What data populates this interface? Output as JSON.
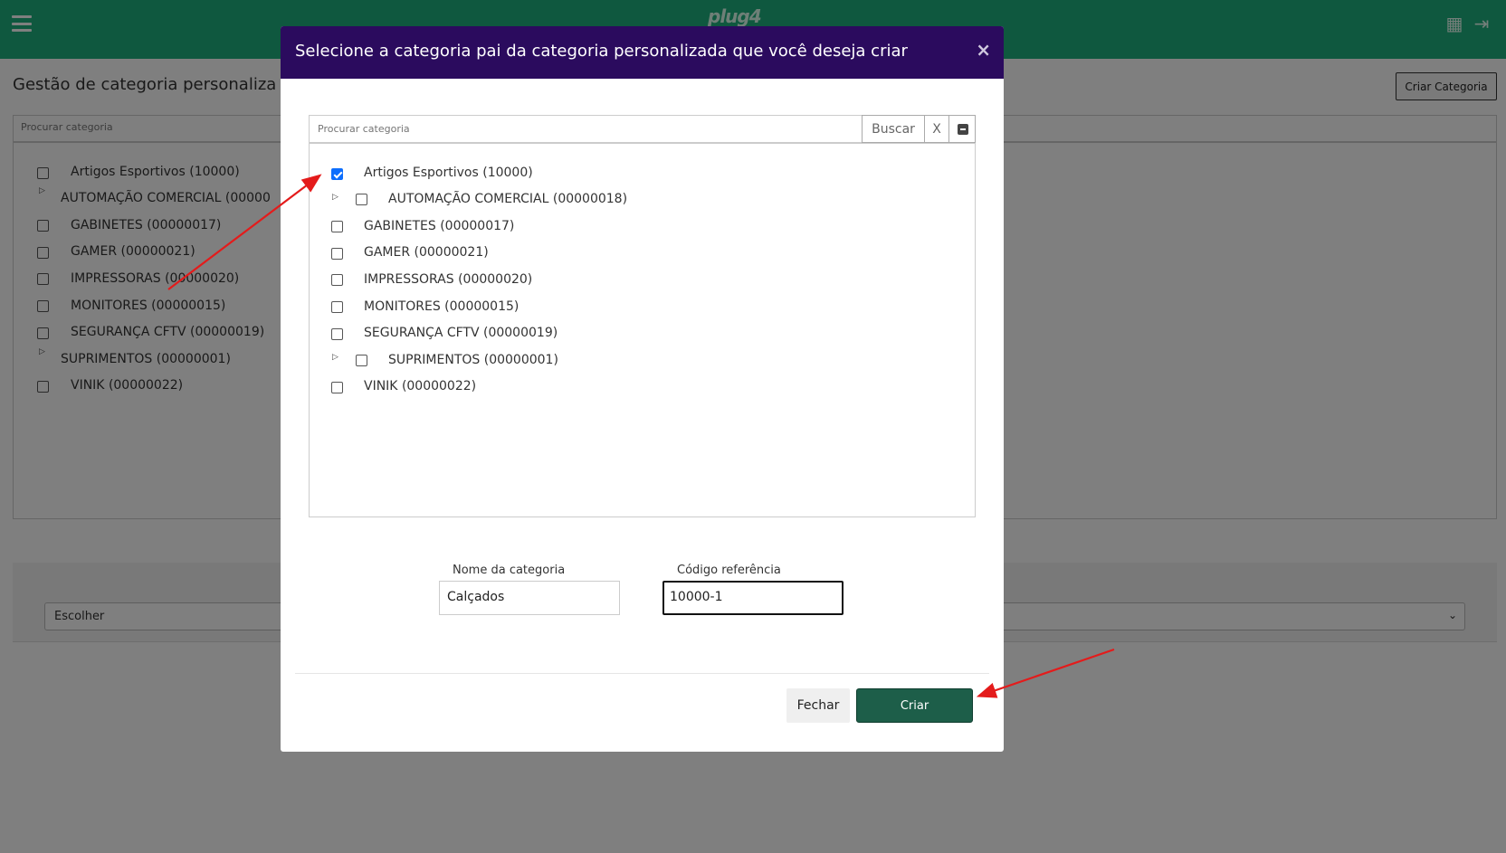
{
  "header": {
    "logo_text": "plug4",
    "colors": {
      "header_bg": "#1fb07f",
      "modal_header_bg": "#2b0b5e",
      "primary_button": "#1d5e49",
      "checkbox_checked": "#0d6efd",
      "annotation_arrow": "#e41b1b"
    }
  },
  "page": {
    "title": "Gestão de categoria personaliza",
    "create_button": "Criar Categoria",
    "search_placeholder": "Procurar categoria",
    "tree": [
      {
        "label": "Artigos Esportivos (10000)",
        "expandable": false
      },
      {
        "label": "AUTOMAÇÃO COMERCIAL (00000",
        "expandable": true
      },
      {
        "label": "GABINETES (00000017)",
        "expandable": false
      },
      {
        "label": "GAMER (00000021)",
        "expandable": false
      },
      {
        "label": "IMPRESSORAS (00000020)",
        "expandable": false
      },
      {
        "label": "MONITORES (00000015)",
        "expandable": false
      },
      {
        "label": "SEGURANÇA CFTV (00000019)",
        "expandable": false
      },
      {
        "label": "SUPRIMENTOS (00000001)",
        "expandable": true
      },
      {
        "label": "VINIK (00000022)",
        "expandable": false
      }
    ],
    "select_value": "Escolher"
  },
  "modal": {
    "title": "Selecione a categoria pai da categoria personalizada que você deseja criar",
    "close_symbol": "×",
    "search": {
      "placeholder": "Procurar categoria",
      "search_button": "Buscar",
      "clear_button": "X"
    },
    "tree": [
      {
        "label": "Artigos Esportivos (10000)",
        "checked": true,
        "expandable": false
      },
      {
        "label": "AUTOMAÇÃO COMERCIAL (00000018)",
        "checked": false,
        "expandable": true
      },
      {
        "label": "GABINETES (00000017)",
        "checked": false,
        "expandable": false
      },
      {
        "label": "GAMER (00000021)",
        "checked": false,
        "expandable": false
      },
      {
        "label": "IMPRESSORAS (00000020)",
        "checked": false,
        "expandable": false
      },
      {
        "label": "MONITORES (00000015)",
        "checked": false,
        "expandable": false
      },
      {
        "label": "SEGURANÇA CFTV (00000019)",
        "checked": false,
        "expandable": false
      },
      {
        "label": "SUPRIMENTOS (00000001)",
        "checked": false,
        "expandable": true
      },
      {
        "label": "VINIK (00000022)",
        "checked": false,
        "expandable": false
      }
    ],
    "form": {
      "name_label": "Nome da categoria",
      "name_value": "Calçados",
      "code_label": "Código referência",
      "code_value": "10000-1"
    },
    "buttons": {
      "close": "Fechar",
      "create": "Criar"
    }
  }
}
